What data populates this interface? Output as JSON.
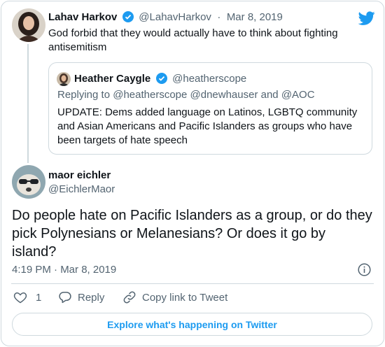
{
  "embed": {
    "parent_tweet": {
      "name": "Lahav Harkov",
      "handle": "@LahavHarkov",
      "separator": "·",
      "date": "Mar 8, 2019",
      "text_line1": "God forbid that they would actually have to think about fighting",
      "text_line2": "antisemitism",
      "avatar_icon": "profile-photo-woman-dark-hair"
    },
    "quoted_tweet": {
      "name": "Heather Caygle",
      "handle": "@heatherscope",
      "replying_to": "Replying to @heatherscope @dnewhauser and @AOC",
      "text_line1": "UPDATE: Dems added language on Latinos, LGBTQ community",
      "text_line2": "and Asian Americans and Pacific Islanders as groups who have",
      "text_line3": "been targets of hate speech",
      "avatar_icon": "profile-photo-woman"
    },
    "main_tweet": {
      "name": "maor eichler",
      "handle": "@EichlerMaor",
      "text_line1": "Do people hate on Pacific Islanders as a group, or do they",
      "text_line2": "pick Polynesians or Melanesians? Or does it go by",
      "text_line3": "island?",
      "timestamp": "4:19 PM · Mar 8, 2019",
      "avatar_icon": "profile-photo-dog-sunglasses"
    },
    "actions": {
      "like_count": "1",
      "reply_label": "Reply",
      "copy_link_label": "Copy link to Tweet"
    },
    "explore_label": "Explore what's happening on Twitter",
    "icons": {
      "brand": "twitter-bird-icon",
      "verified": "verified-badge-icon",
      "info": "info-icon",
      "like": "heart-icon",
      "reply": "reply-bubble-icon",
      "copy_link": "link-icon"
    },
    "colors": {
      "brand_blue": "#1d9bf0",
      "text": "#0f1419",
      "secondary_text": "#536471",
      "border": "#cfd9de"
    }
  }
}
